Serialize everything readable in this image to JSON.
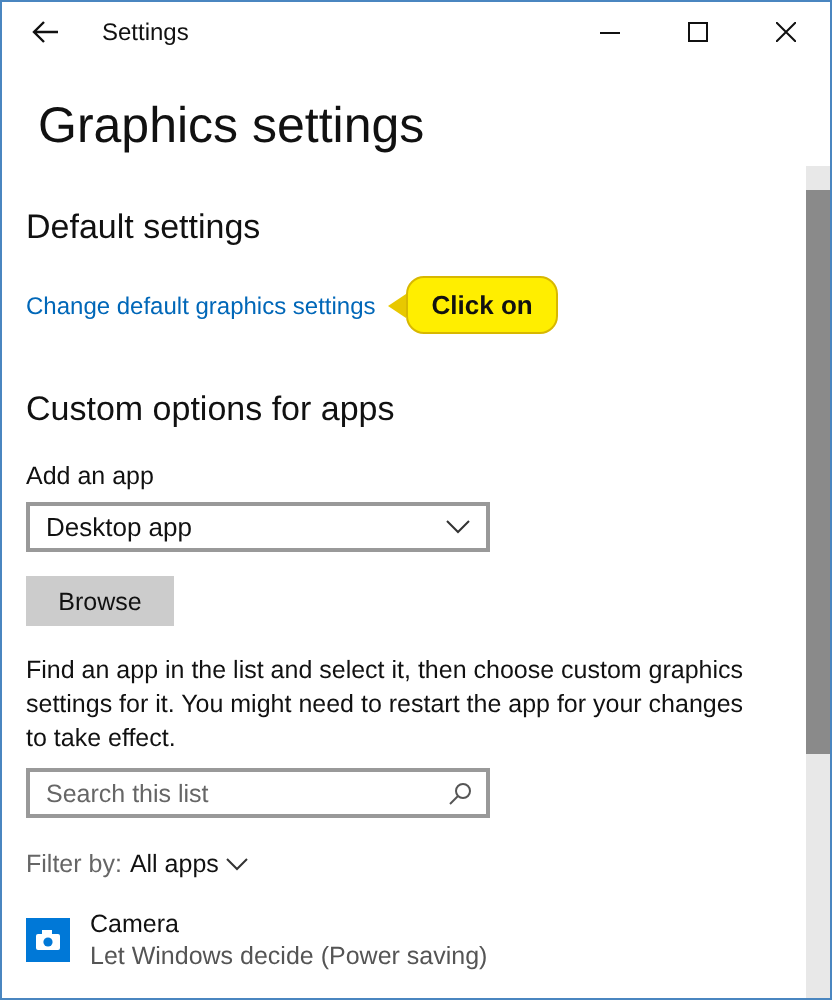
{
  "window": {
    "title": "Settings"
  },
  "page_title": "Graphics settings",
  "default_section": {
    "heading": "Default settings",
    "link": "Change default graphics settings",
    "callout": "Click on"
  },
  "custom_section": {
    "heading": "Custom options for apps",
    "add_label": "Add an app",
    "dropdown_value": "Desktop app",
    "browse_button": "Browse",
    "description": "Find an app in the list and select it, then choose custom graphics settings for it. You might need to restart the app for your changes to take effect.",
    "search_placeholder": "Search this list",
    "filter_label": "Filter by:",
    "filter_value": "All apps"
  },
  "apps": [
    {
      "name": "Camera",
      "setting": "Let Windows decide (Power saving)"
    }
  ]
}
